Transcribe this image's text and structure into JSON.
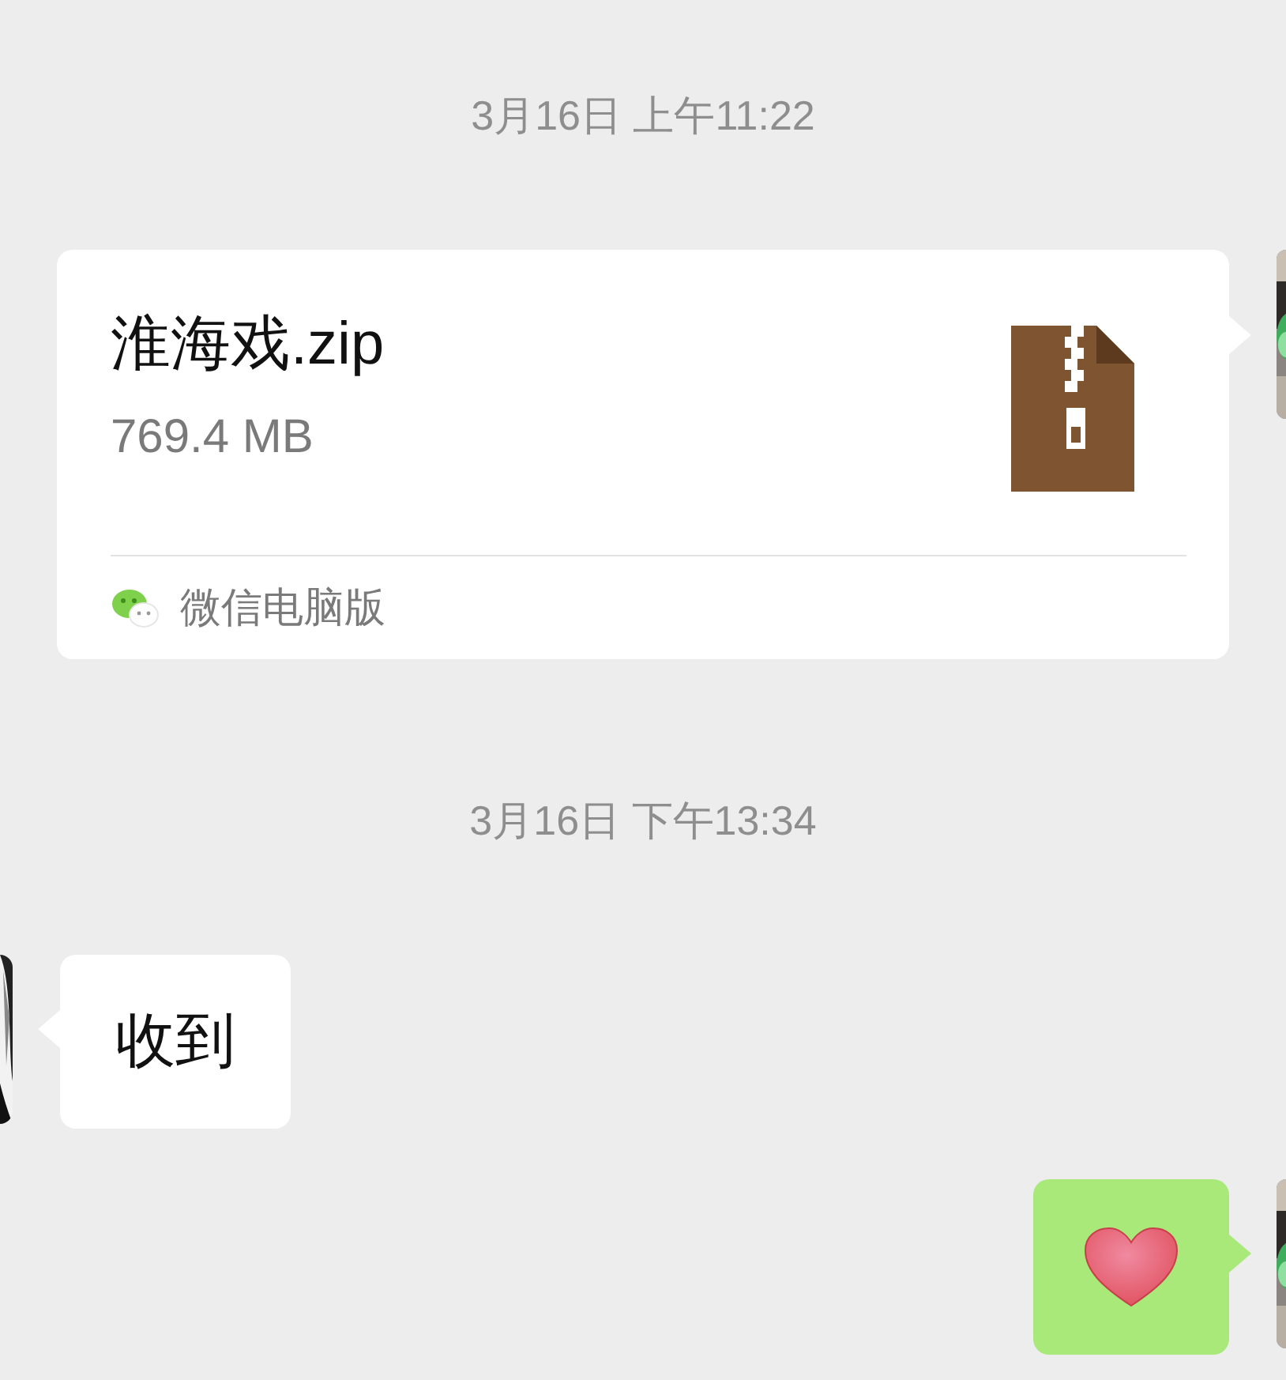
{
  "messages": [
    {
      "kind": "time",
      "text": "3月16日 上午11:22"
    },
    {
      "kind": "file",
      "outgoing": true,
      "name": "淮海戏.zip",
      "size": "769.4 MB",
      "source": "微信电脑版"
    },
    {
      "kind": "time",
      "text": "3月16日 下午13:34"
    },
    {
      "kind": "text",
      "outgoing": false,
      "text": "收到"
    },
    {
      "kind": "sticker",
      "outgoing": true
    }
  ]
}
